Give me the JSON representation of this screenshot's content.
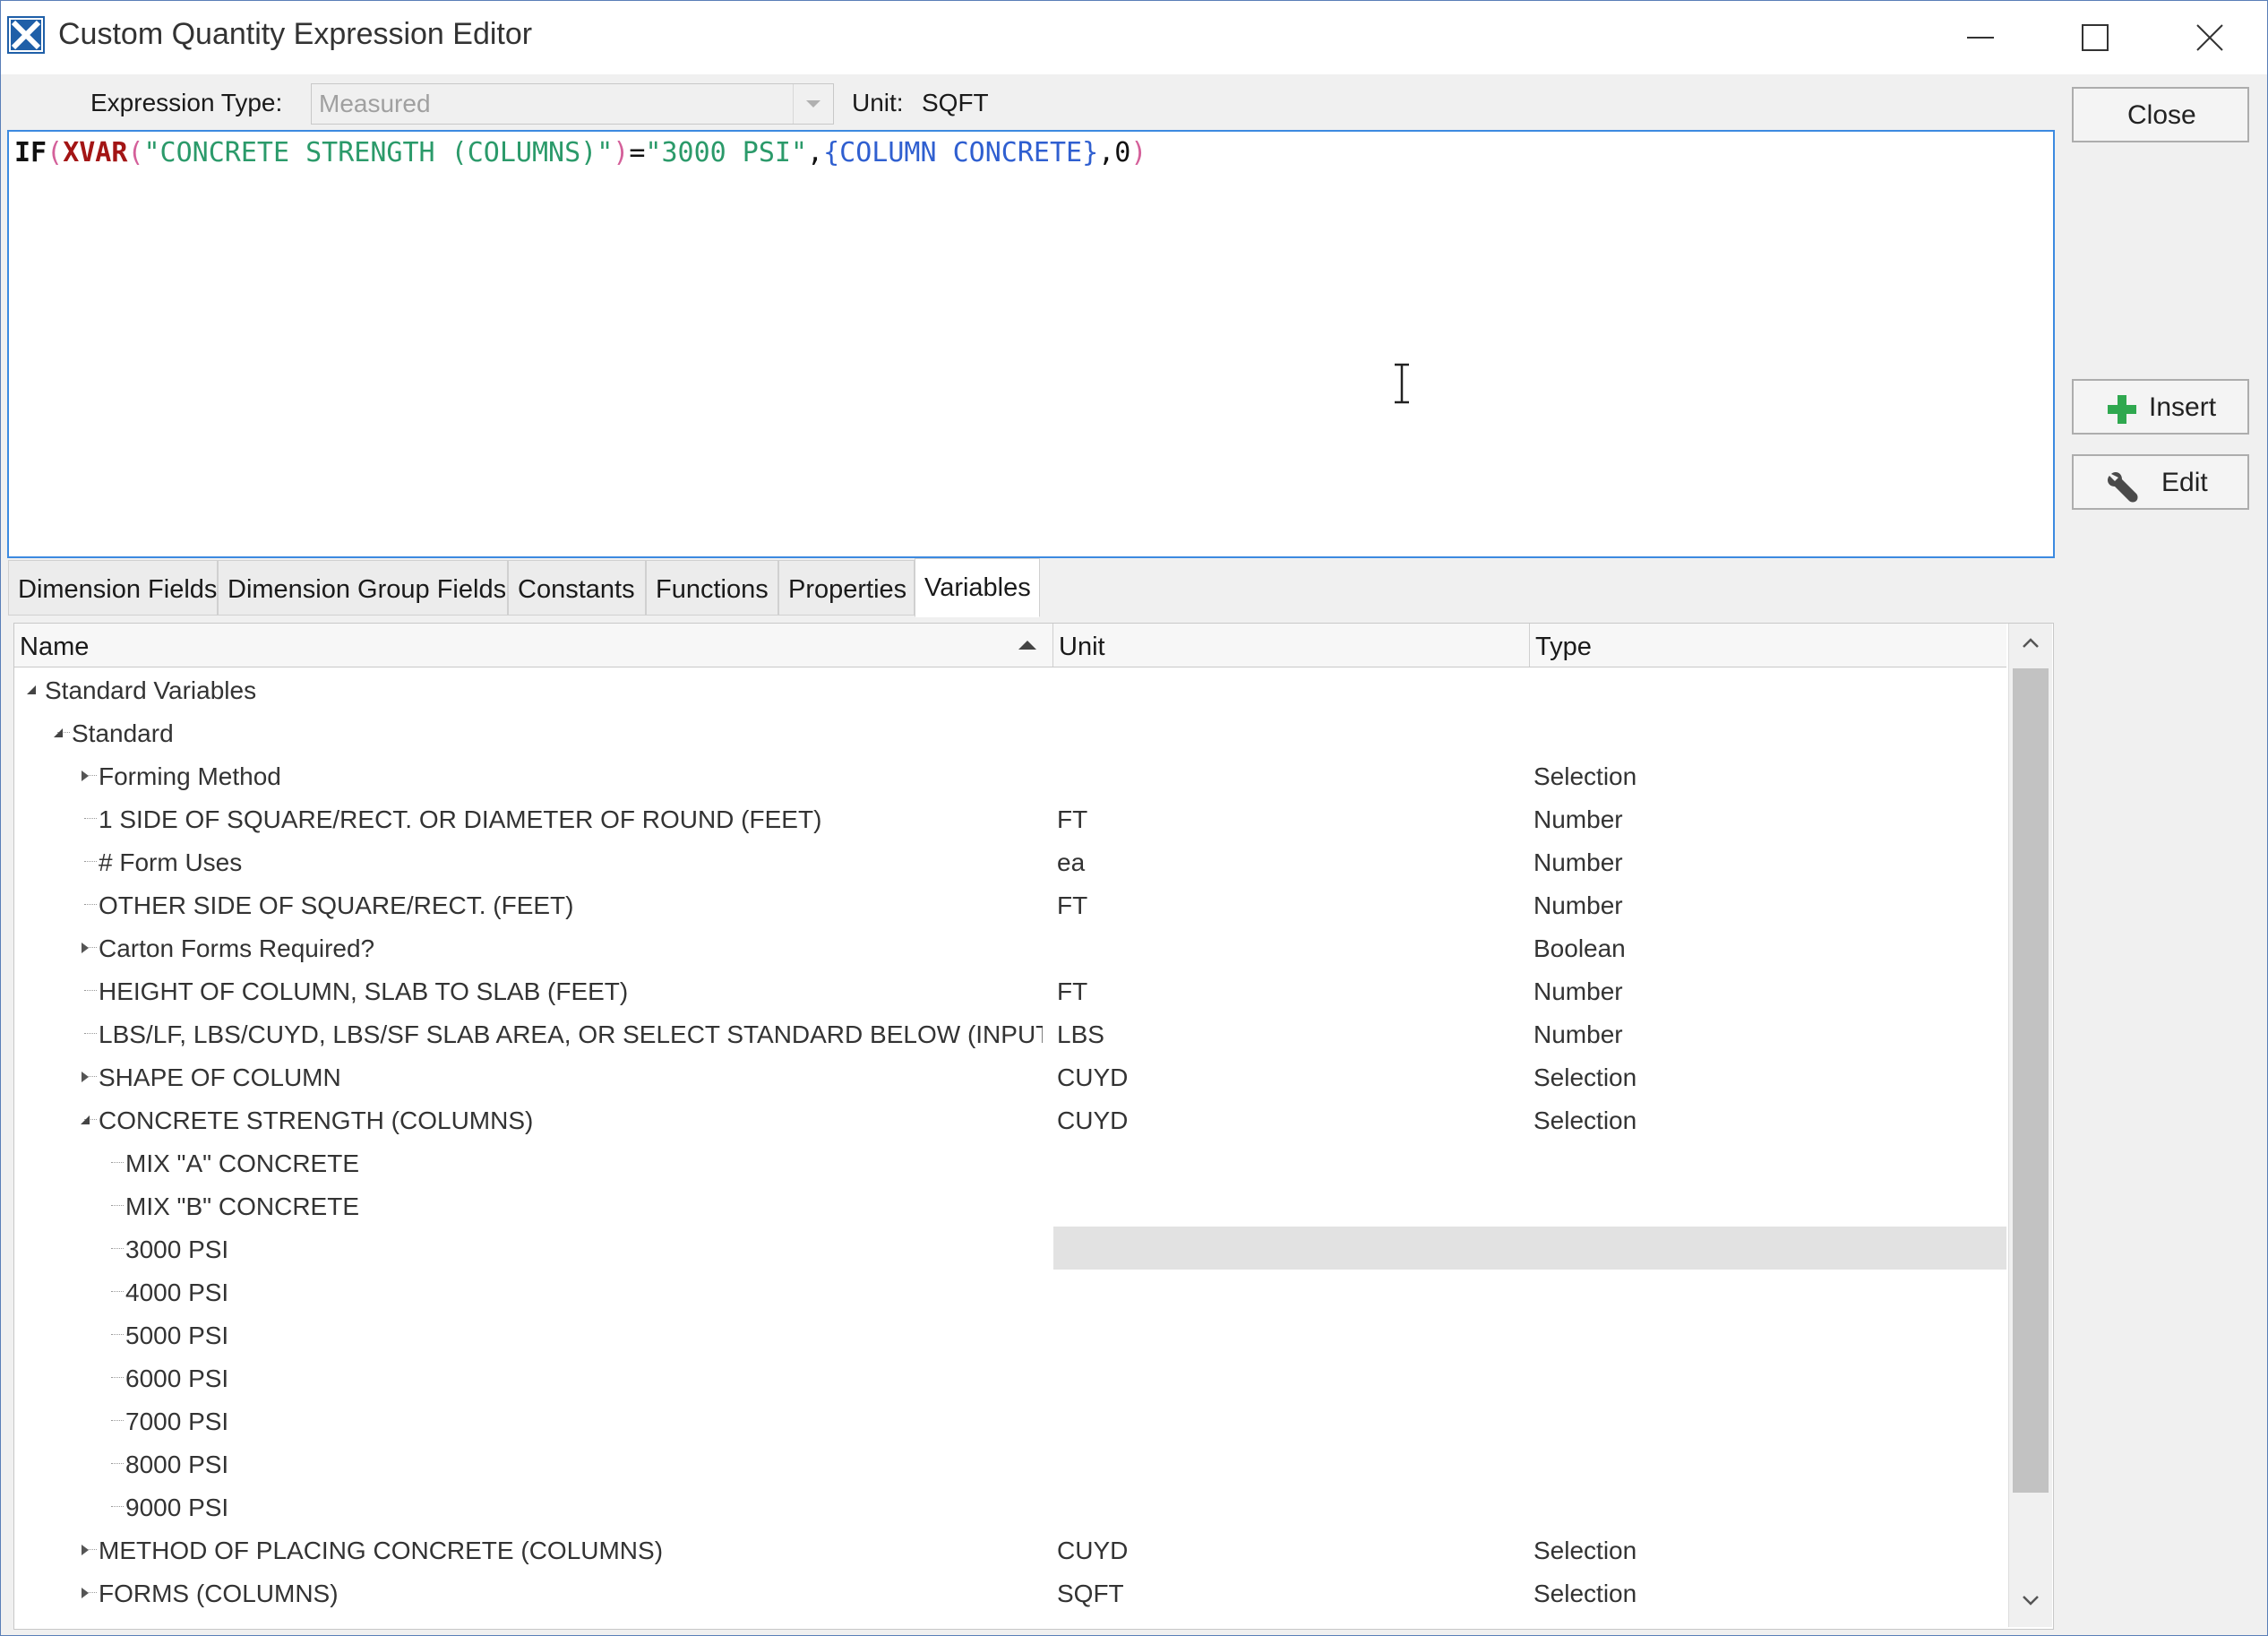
{
  "window": {
    "title": "Custom Quantity Expression Editor"
  },
  "header": {
    "expression_type_label": "Expression Type:",
    "expression_type_value": "Measured",
    "unit_label": "Unit:",
    "unit_value": "SQFT"
  },
  "editor": {
    "tokens": {
      "t1": "IF",
      "t2": "(",
      "t3": "XVAR",
      "t4": "(",
      "t5": "\"CONCRETE STRENGTH (COLUMNS)\"",
      "t6": ")",
      "t7": "=",
      "t8": "\"3000 PSI\"",
      "t9": ",",
      "t10": "{COLUMN CONCRETE}",
      "t11": ",",
      "t12": "0",
      "t13": ")"
    }
  },
  "buttons": {
    "close": "Close",
    "insert": "Insert",
    "edit": "Edit"
  },
  "tabs": [
    "Dimension Fields",
    "Dimension Group Fields",
    "Constants",
    "Functions",
    "Properties",
    "Variables"
  ],
  "active_tab": "Variables",
  "grid": {
    "columns": [
      "Name",
      "Unit",
      "Type"
    ],
    "rows": [
      {
        "name": "Standard Variables",
        "unit": "",
        "type": ""
      },
      {
        "name": "Standard",
        "unit": "",
        "type": ""
      },
      {
        "name": "Forming Method",
        "unit": "",
        "type": "Selection"
      },
      {
        "name": "1 SIDE OF SQUARE/RECT. OR DIAMETER OF ROUND (FEET)",
        "unit": "FT",
        "type": "Number"
      },
      {
        "name": "# Form Uses",
        "unit": "ea",
        "type": "Number"
      },
      {
        "name": "OTHER SIDE OF SQUARE/RECT. (FEET)",
        "unit": "FT",
        "type": "Number"
      },
      {
        "name": "Carton Forms Required?",
        "unit": "",
        "type": "Boolean"
      },
      {
        "name": "HEIGHT OF COLUMN, SLAB TO SLAB (FEET)",
        "unit": "FT",
        "type": "Number"
      },
      {
        "name": "LBS/LF, LBS/CUYD, LBS/SF SLAB AREA, OR SELECT STANDARD BELOW (INPUT",
        "unit": "LBS",
        "type": "Number"
      },
      {
        "name": "SHAPE OF COLUMN",
        "unit": "CUYD",
        "type": "Selection"
      },
      {
        "name": "CONCRETE STRENGTH (COLUMNS)",
        "unit": "CUYD",
        "type": "Selection"
      },
      {
        "name": "MIX \"A\" CONCRETE",
        "unit": "",
        "type": ""
      },
      {
        "name": "MIX \"B\" CONCRETE",
        "unit": "",
        "type": ""
      },
      {
        "name": "3000 PSI",
        "unit": "",
        "type": ""
      },
      {
        "name": "4000 PSI",
        "unit": "",
        "type": ""
      },
      {
        "name": "5000 PSI",
        "unit": "",
        "type": ""
      },
      {
        "name": "6000 PSI",
        "unit": "",
        "type": ""
      },
      {
        "name": "7000 PSI",
        "unit": "",
        "type": ""
      },
      {
        "name": "8000 PSI",
        "unit": "",
        "type": ""
      },
      {
        "name": "9000 PSI",
        "unit": "",
        "type": ""
      },
      {
        "name": "METHOD OF PLACING CONCRETE (COLUMNS)",
        "unit": "CUYD",
        "type": "Selection"
      },
      {
        "name": "FORMS (COLUMNS)",
        "unit": "SQFT",
        "type": "Selection"
      }
    ],
    "selected_row": "3000 PSI"
  },
  "icons": {
    "app": "app-icon",
    "minimize": "minimize-icon",
    "maximize": "maximize-icon",
    "close": "close-icon",
    "insert": "plus-icon",
    "edit": "wrench-icon"
  },
  "colors": {
    "accent_border": "#3c8ae0",
    "insert_icon": "#2fa84f",
    "string_token": "#2b9a6a",
    "reference_token": "#2f5fd0",
    "function_token": "#a31515"
  }
}
